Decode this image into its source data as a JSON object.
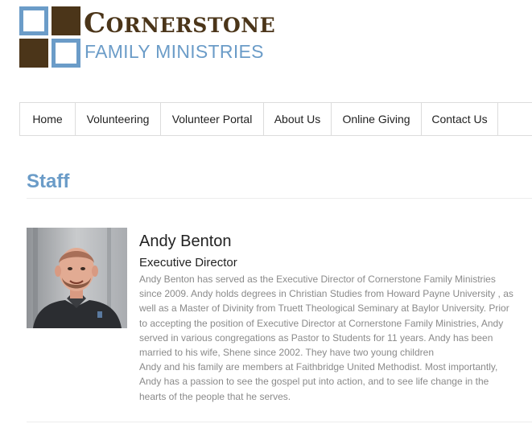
{
  "logo": {
    "title_first": "C",
    "title_rest": "ORNERSTONE",
    "subtitle": "FAMILY MINISTRIES",
    "colors": {
      "brown": "#4b3519",
      "blue": "#6b9cc8"
    }
  },
  "nav": {
    "items": [
      {
        "label": "Home"
      },
      {
        "label": "Volunteering"
      },
      {
        "label": "Volunteer Portal"
      },
      {
        "label": "About Us"
      },
      {
        "label": "Online Giving"
      },
      {
        "label": "Contact Us"
      }
    ]
  },
  "page": {
    "title": "Staff"
  },
  "staff": [
    {
      "name": "Andy Benton",
      "role": "Executive Director",
      "bio_lines": [
        "Andy Benton has served as the Executive Director of Cornerstone Family Ministries",
        "since 2009.  Andy holds degrees in Christian Studies from Howard Payne University , as",
        "well as a  Master of Divinity from Truett Theological Seminary at Baylor University.  Prior",
        "to accepting the position of Executive Director at Cornerstone Family Ministries, Andy",
        "served in various congregations as Pastor to Students for 11 years.  Andy has been",
        "married to his wife, Shene since 2002.  They have two young children",
        " Andy and his family are members at Faithbridge United Methodist.  Most importantly,",
        "Andy has a passion to see the gospel put into action, and to see life change in the",
        "hearts of the people that he serves."
      ]
    }
  ]
}
